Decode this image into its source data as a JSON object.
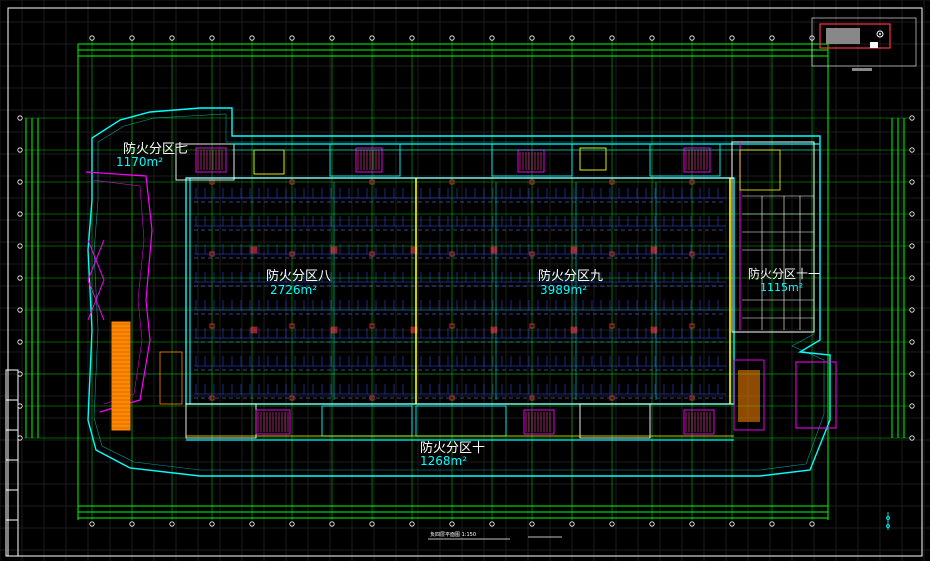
{
  "drawing": {
    "background": "#000000",
    "colors": {
      "grid_axis": "#00ff00",
      "wall": "#00ffff",
      "column": "#ff3344",
      "stair": "#ff00ff",
      "yellow": "#ffff00",
      "white": "#ffffff",
      "orange": "#ff8800",
      "blue": "#3355ff",
      "pink": "#ff4466"
    },
    "fire_zones": [
      {
        "name": "防火分区七",
        "area": "1170m²"
      },
      {
        "name": "防火分区八",
        "area": "2726m²"
      },
      {
        "name": "防火分区九",
        "area": "3989m²"
      },
      {
        "name": "防火分区十一",
        "area": "1115m²"
      },
      {
        "name": "防火分区十",
        "area": "1268m²"
      }
    ],
    "sheet_title": "负四层平面图  1:150"
  }
}
